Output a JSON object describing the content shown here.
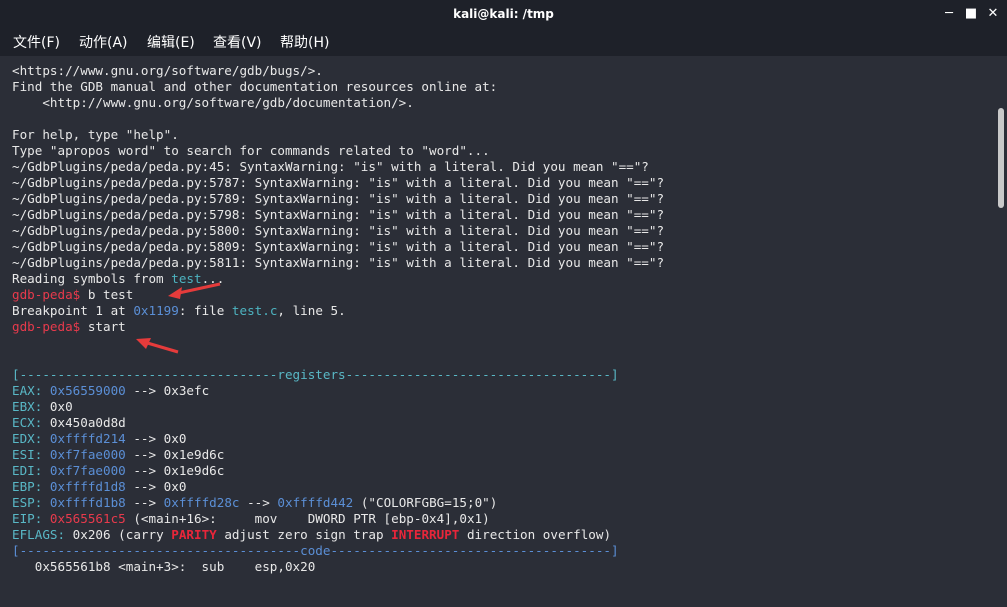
{
  "window": {
    "title": "kali@kali: /tmp",
    "minimize_icon": "minimize-icon",
    "maximize_icon": "maximize-icon",
    "close_icon": "close-icon"
  },
  "menu": [
    {
      "label": "文件(F)"
    },
    {
      "label": "动作(A)"
    },
    {
      "label": "编辑(E)"
    },
    {
      "label": "查看(V)"
    },
    {
      "label": "帮助(H)"
    }
  ],
  "colors": {
    "background": "#2b2e37",
    "prompt_red": "#e83a4c",
    "address_blue": "#5b8fd6",
    "banner_cyan": "#4db3c0"
  },
  "terminal": {
    "header_lines": [
      "<https://www.gnu.org/software/gdb/bugs/>.",
      "Find the GDB manual and other documentation resources online at:",
      "    <http://www.gnu.org/software/gdb/documentation/>.",
      "",
      "For help, type \"help\".",
      "Type \"apropos word\" to search for commands related to \"word\"...",
      "~/GdbPlugins/peda/peda.py:45: SyntaxWarning: \"is\" with a literal. Did you mean \"==\"?",
      "~/GdbPlugins/peda/peda.py:5787: SyntaxWarning: \"is\" with a literal. Did you mean \"==\"?",
      "~/GdbPlugins/peda/peda.py:5789: SyntaxWarning: \"is\" with a literal. Did you mean \"==\"?",
      "~/GdbPlugins/peda/peda.py:5798: SyntaxWarning: \"is\" with a literal. Did you mean \"==\"?",
      "~/GdbPlugins/peda/peda.py:5800: SyntaxWarning: \"is\" with a literal. Did you mean \"==\"?",
      "~/GdbPlugins/peda/peda.py:5809: SyntaxWarning: \"is\" with a literal. Did you mean \"==\"?",
      "~/GdbPlugins/peda/peda.py:5811: SyntaxWarning: \"is\" with a literal. Did you mean \"==\"?"
    ],
    "reading_prefix": "Reading symbols from ",
    "reading_file": "test",
    "reading_suffix": "...",
    "prompt": "gdb-peda$",
    "cmd1": " b test",
    "bp_prefix": "Breakpoint 1 at ",
    "bp_addr": "0x1199",
    "bp_mid": ": file ",
    "bp_file": "test.c",
    "bp_suffix": ", line 5.",
    "cmd2": " start",
    "registers_banner": "[----------------------------------registers-----------------------------------]",
    "registers": {
      "eax_label": "EAX: ",
      "eax_val": "0x56559000",
      "eax_arrow": " --> ",
      "eax_deref": "0x3efc",
      "ebx_label": "EBX: ",
      "ebx_val": "0x0",
      "ecx_label": "ECX: ",
      "ecx_val": "0x450a0d8d",
      "edx_label": "EDX: ",
      "edx_val": "0xffffd214",
      "edx_arrow": " --> ",
      "edx_deref": "0x0",
      "esi_label": "ESI: ",
      "esi_val": "0xf7fae000",
      "esi_arrow": " --> ",
      "esi_deref": "0x1e9d6c",
      "edi_label": "EDI: ",
      "edi_val": "0xf7fae000",
      "edi_arrow": " --> ",
      "edi_deref": "0x1e9d6c",
      "ebp_label": "EBP: ",
      "ebp_val": "0xffffd1d8",
      "ebp_arrow": " --> ",
      "ebp_deref": "0x0",
      "esp_label": "ESP: ",
      "esp_val": "0xffffd1b8",
      "esp_arrow1": " --> ",
      "esp_deref1": "0xffffd28c",
      "esp_arrow2": " --> ",
      "esp_deref2": "0xffffd442",
      "esp_str": " (\"COLORFGBG=15;0\")",
      "eip_label": "EIP: ",
      "eip_val": "0x565561c5",
      "eip_rest": " (<main+16>:     mov    DWORD PTR [ebp-0x4],0x1)",
      "eflags_label": "EFLAGS: ",
      "eflags_val": "0x206 ",
      "eflags_open": "(carry ",
      "eflags_parity": "PARITY",
      "eflags_mid": " adjust zero sign trap ",
      "eflags_interrupt": "INTERRUPT",
      "eflags_close": " direction overflow)"
    },
    "code_banner": "[-------------------------------------code-------------------------------------]",
    "code_line": "   0x565561b8 <main+3>:  sub    esp,0x20"
  }
}
